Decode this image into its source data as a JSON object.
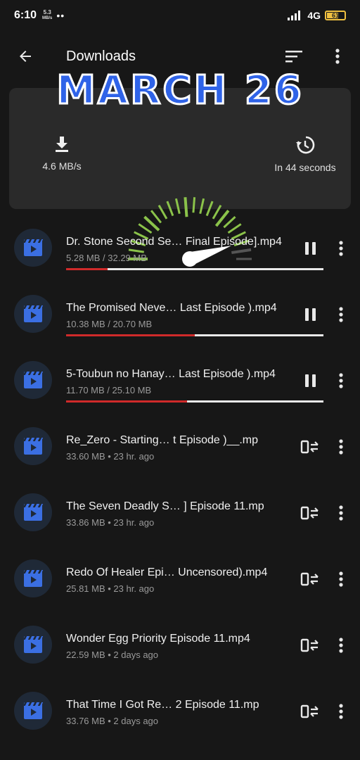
{
  "status_bar": {
    "time": "6:10",
    "speed_value": "5.3",
    "speed_unit": "MB/s",
    "dots": "••",
    "network": "4G",
    "battery": "61"
  },
  "toolbar": {
    "title": "Downloads",
    "back_icon": "arrow-left-icon",
    "sort_icon": "sort-icon",
    "more_icon": "more-vertical-icon"
  },
  "banner": {
    "text": "MARCH 26"
  },
  "speed_card": {
    "download_speed": "4.6 MB/s",
    "eta": "In 44 seconds",
    "download_icon": "download-icon",
    "history_icon": "history-icon",
    "gauge_level": 0.92
  },
  "colors": {
    "background": "#171717",
    "card": "#2a2a2a",
    "progress": "#d02a2a",
    "gauge_green": "#8bc34a",
    "icon_blue": "#3b6fe3"
  },
  "downloads": [
    {
      "name": "Dr. Stone Second Se…  Final Episode].mp4",
      "meta": "5.28 MB / 32.29 MB",
      "progress": 0.16,
      "state": "downloading",
      "action_icon": "pause-icon"
    },
    {
      "name": "The Promised Neve…  Last Episode ).mp4",
      "meta": "10.38 MB / 20.70 MB",
      "progress": 0.5,
      "state": "downloading",
      "action_icon": "pause-icon"
    },
    {
      "name": "5-Toubun no Hanay…  Last Episode ).mp4",
      "meta": "11.70 MB / 25.10 MB",
      "progress": 0.47,
      "state": "downloading",
      "action_icon": "pause-icon"
    },
    {
      "name": "Re_Zero - Starting…     t Episode )__.mp",
      "meta": "33.60 MB  •  23 hr. ago",
      "state": "completed",
      "action_icon": "open-external-icon"
    },
    {
      "name": "The Seven Deadly S…  ] Episode 11.mp",
      "meta": "33.86 MB  •  23 hr. ago",
      "state": "completed",
      "action_icon": "open-external-icon"
    },
    {
      "name": "Redo Of Healer Epi… Uncensored).mp4",
      "meta": "25.81 MB  •  23 hr. ago",
      "state": "completed",
      "action_icon": "open-external-icon"
    },
    {
      "name": "Wonder Egg Priority Episode 11.mp4",
      "meta": "22.59 MB  •  2 days ago",
      "state": "completed",
      "action_icon": "open-external-icon"
    },
    {
      "name": "That Time I Got Re…  2 Episode 11.mp",
      "meta": "33.76 MB  •  2 days ago",
      "state": "completed",
      "action_icon": "open-external-icon"
    }
  ]
}
